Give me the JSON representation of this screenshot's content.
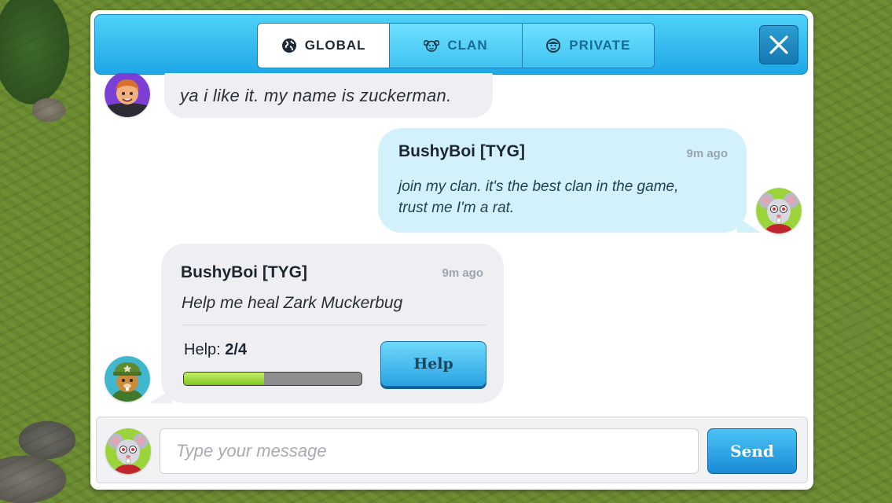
{
  "tabs": [
    {
      "label": "GLOBAL",
      "icon": "globe-icon",
      "active": true
    },
    {
      "label": "CLAN",
      "icon": "clan-icon",
      "active": false
    },
    {
      "label": "PRIVATE",
      "icon": "private-icon",
      "active": false
    }
  ],
  "messages": [
    {
      "text": "ya i like it. my name is zuckerman.",
      "avatar": "zuckerman-avatar",
      "side": "left"
    },
    {
      "sender": "BushyBoi [TYG]",
      "time": "9m ago",
      "line1": "join my clan. it's the best clan in the game,",
      "line2": "trust me I'm a rat.",
      "avatar": "rat-avatar",
      "side": "right"
    },
    {
      "sender": "BushyBoi [TYG]",
      "time": "9m ago",
      "text": "Help me heal Zark Muckerbug",
      "help_label": "Help:",
      "help_value": "2/4",
      "help_button": "Help",
      "progress": 0.45,
      "avatar": "soldier-avatar",
      "side": "left"
    }
  ],
  "input": {
    "placeholder": "Type your message",
    "send_label": "Send"
  },
  "colors": {
    "header": "#2bb3ee",
    "own_bubble": "#d2f1fb",
    "other_bubble": "#efeff3",
    "progress_fill": "#9bd635"
  }
}
